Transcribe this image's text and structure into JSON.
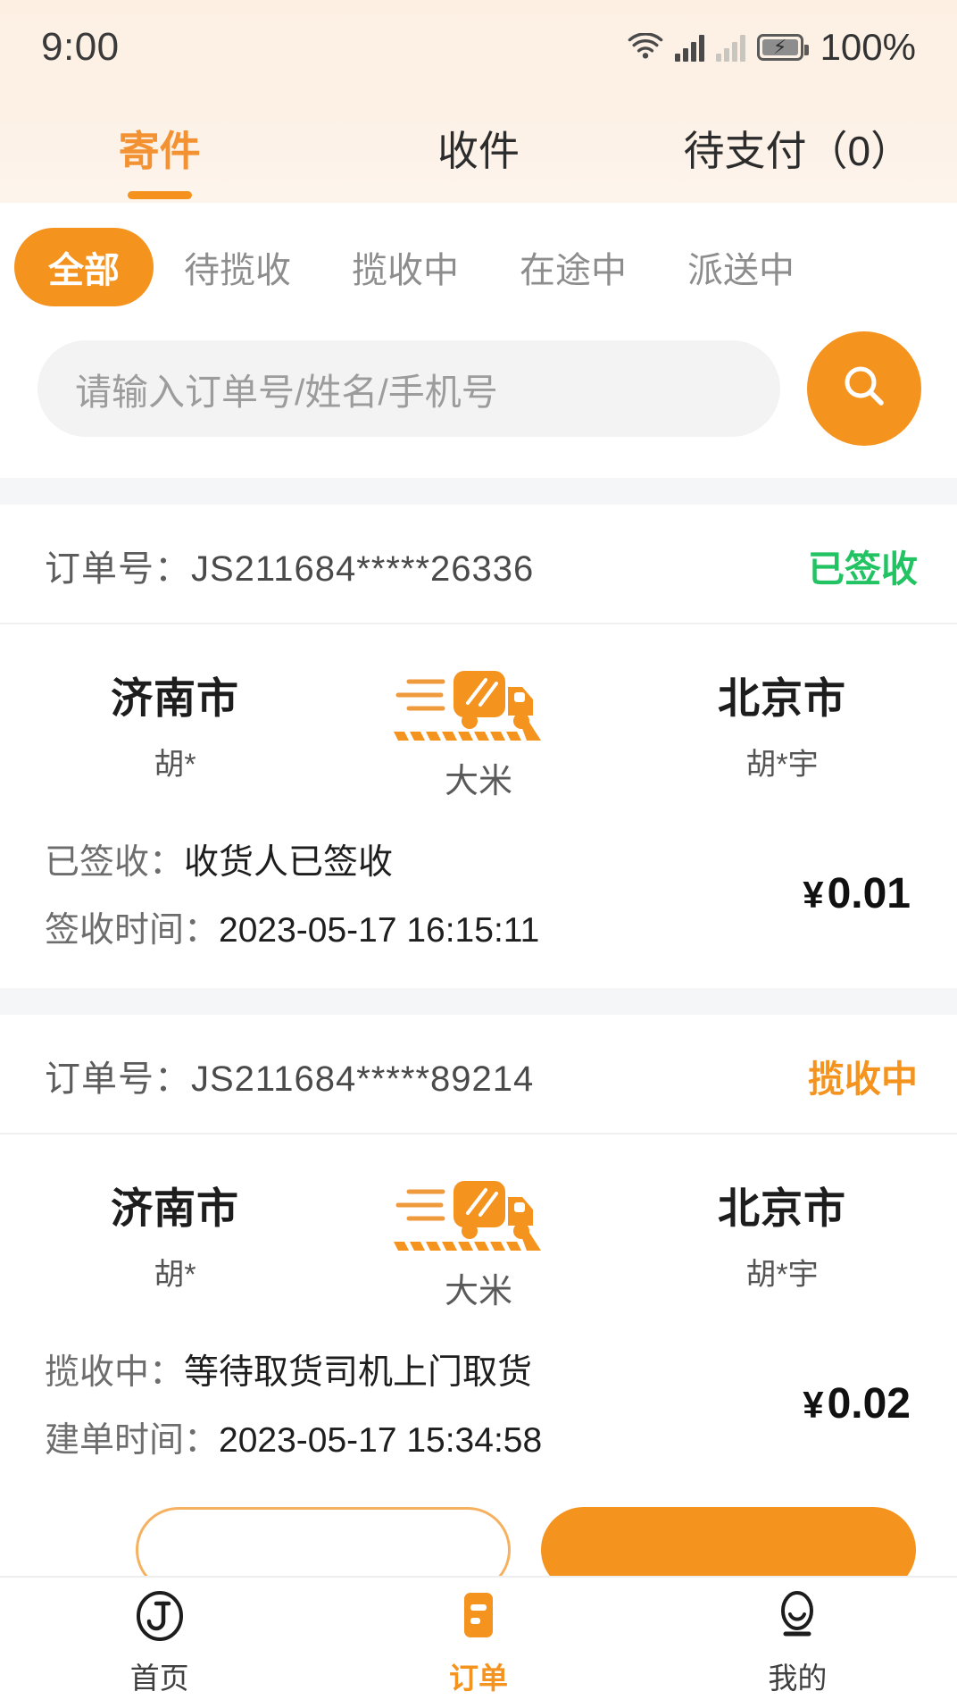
{
  "statusbar": {
    "time": "9:00",
    "battery_percent": "100%",
    "icons": [
      "wifi-icon",
      "signal-icon",
      "signal-icon-secondary",
      "battery-charging-icon"
    ]
  },
  "main_tabs": [
    {
      "label": "寄件",
      "active": true
    },
    {
      "label": "收件",
      "active": false
    },
    {
      "label": "待支付（0）",
      "active": false
    }
  ],
  "filters": [
    {
      "label": "全部",
      "active": true
    },
    {
      "label": "待揽收",
      "active": false
    },
    {
      "label": "揽收中",
      "active": false
    },
    {
      "label": "在途中",
      "active": false
    },
    {
      "label": "派送中",
      "active": false
    }
  ],
  "search": {
    "placeholder": "请输入订单号/姓名/手机号",
    "value": "",
    "button_icon": "search-icon"
  },
  "orders": [
    {
      "order_label": "订单号：",
      "order_no": "JS211684*****26336",
      "status": "已签收",
      "status_color": "#22c362",
      "from_city": "济南市",
      "from_person": "胡*",
      "to_city": "北京市",
      "to_person": "胡*宇",
      "cargo": "大米",
      "detail_status_label": "已签收：",
      "detail_status_value": "收货人已签收",
      "time_label": "签收时间：",
      "time_value": "2023-05-17 16:15:11",
      "price": "0.01",
      "currency": "¥"
    },
    {
      "order_label": "订单号：",
      "order_no": "JS211684*****89214",
      "status": "揽收中",
      "status_color": "#f5931f",
      "from_city": "济南市",
      "from_person": "胡*",
      "to_city": "北京市",
      "to_person": "胡*宇",
      "cargo": "大米",
      "detail_status_label": "揽收中：",
      "detail_status_value": "等待取货司机上门取货",
      "time_label": "建单时间：",
      "time_value": "2023-05-17 15:34:58",
      "price": "0.02",
      "currency": "¥"
    }
  ],
  "bottom_nav": [
    {
      "label": "首页",
      "icon": "home-logo-icon",
      "active": false
    },
    {
      "label": "订单",
      "icon": "order-list-icon",
      "active": true
    },
    {
      "label": "我的",
      "icon": "profile-icon",
      "active": false
    }
  ],
  "theme": {
    "accent": "#f5931f",
    "success": "#22c362",
    "page_bg": "#f5f6f7",
    "top_gradient": "#fdf0e3"
  }
}
